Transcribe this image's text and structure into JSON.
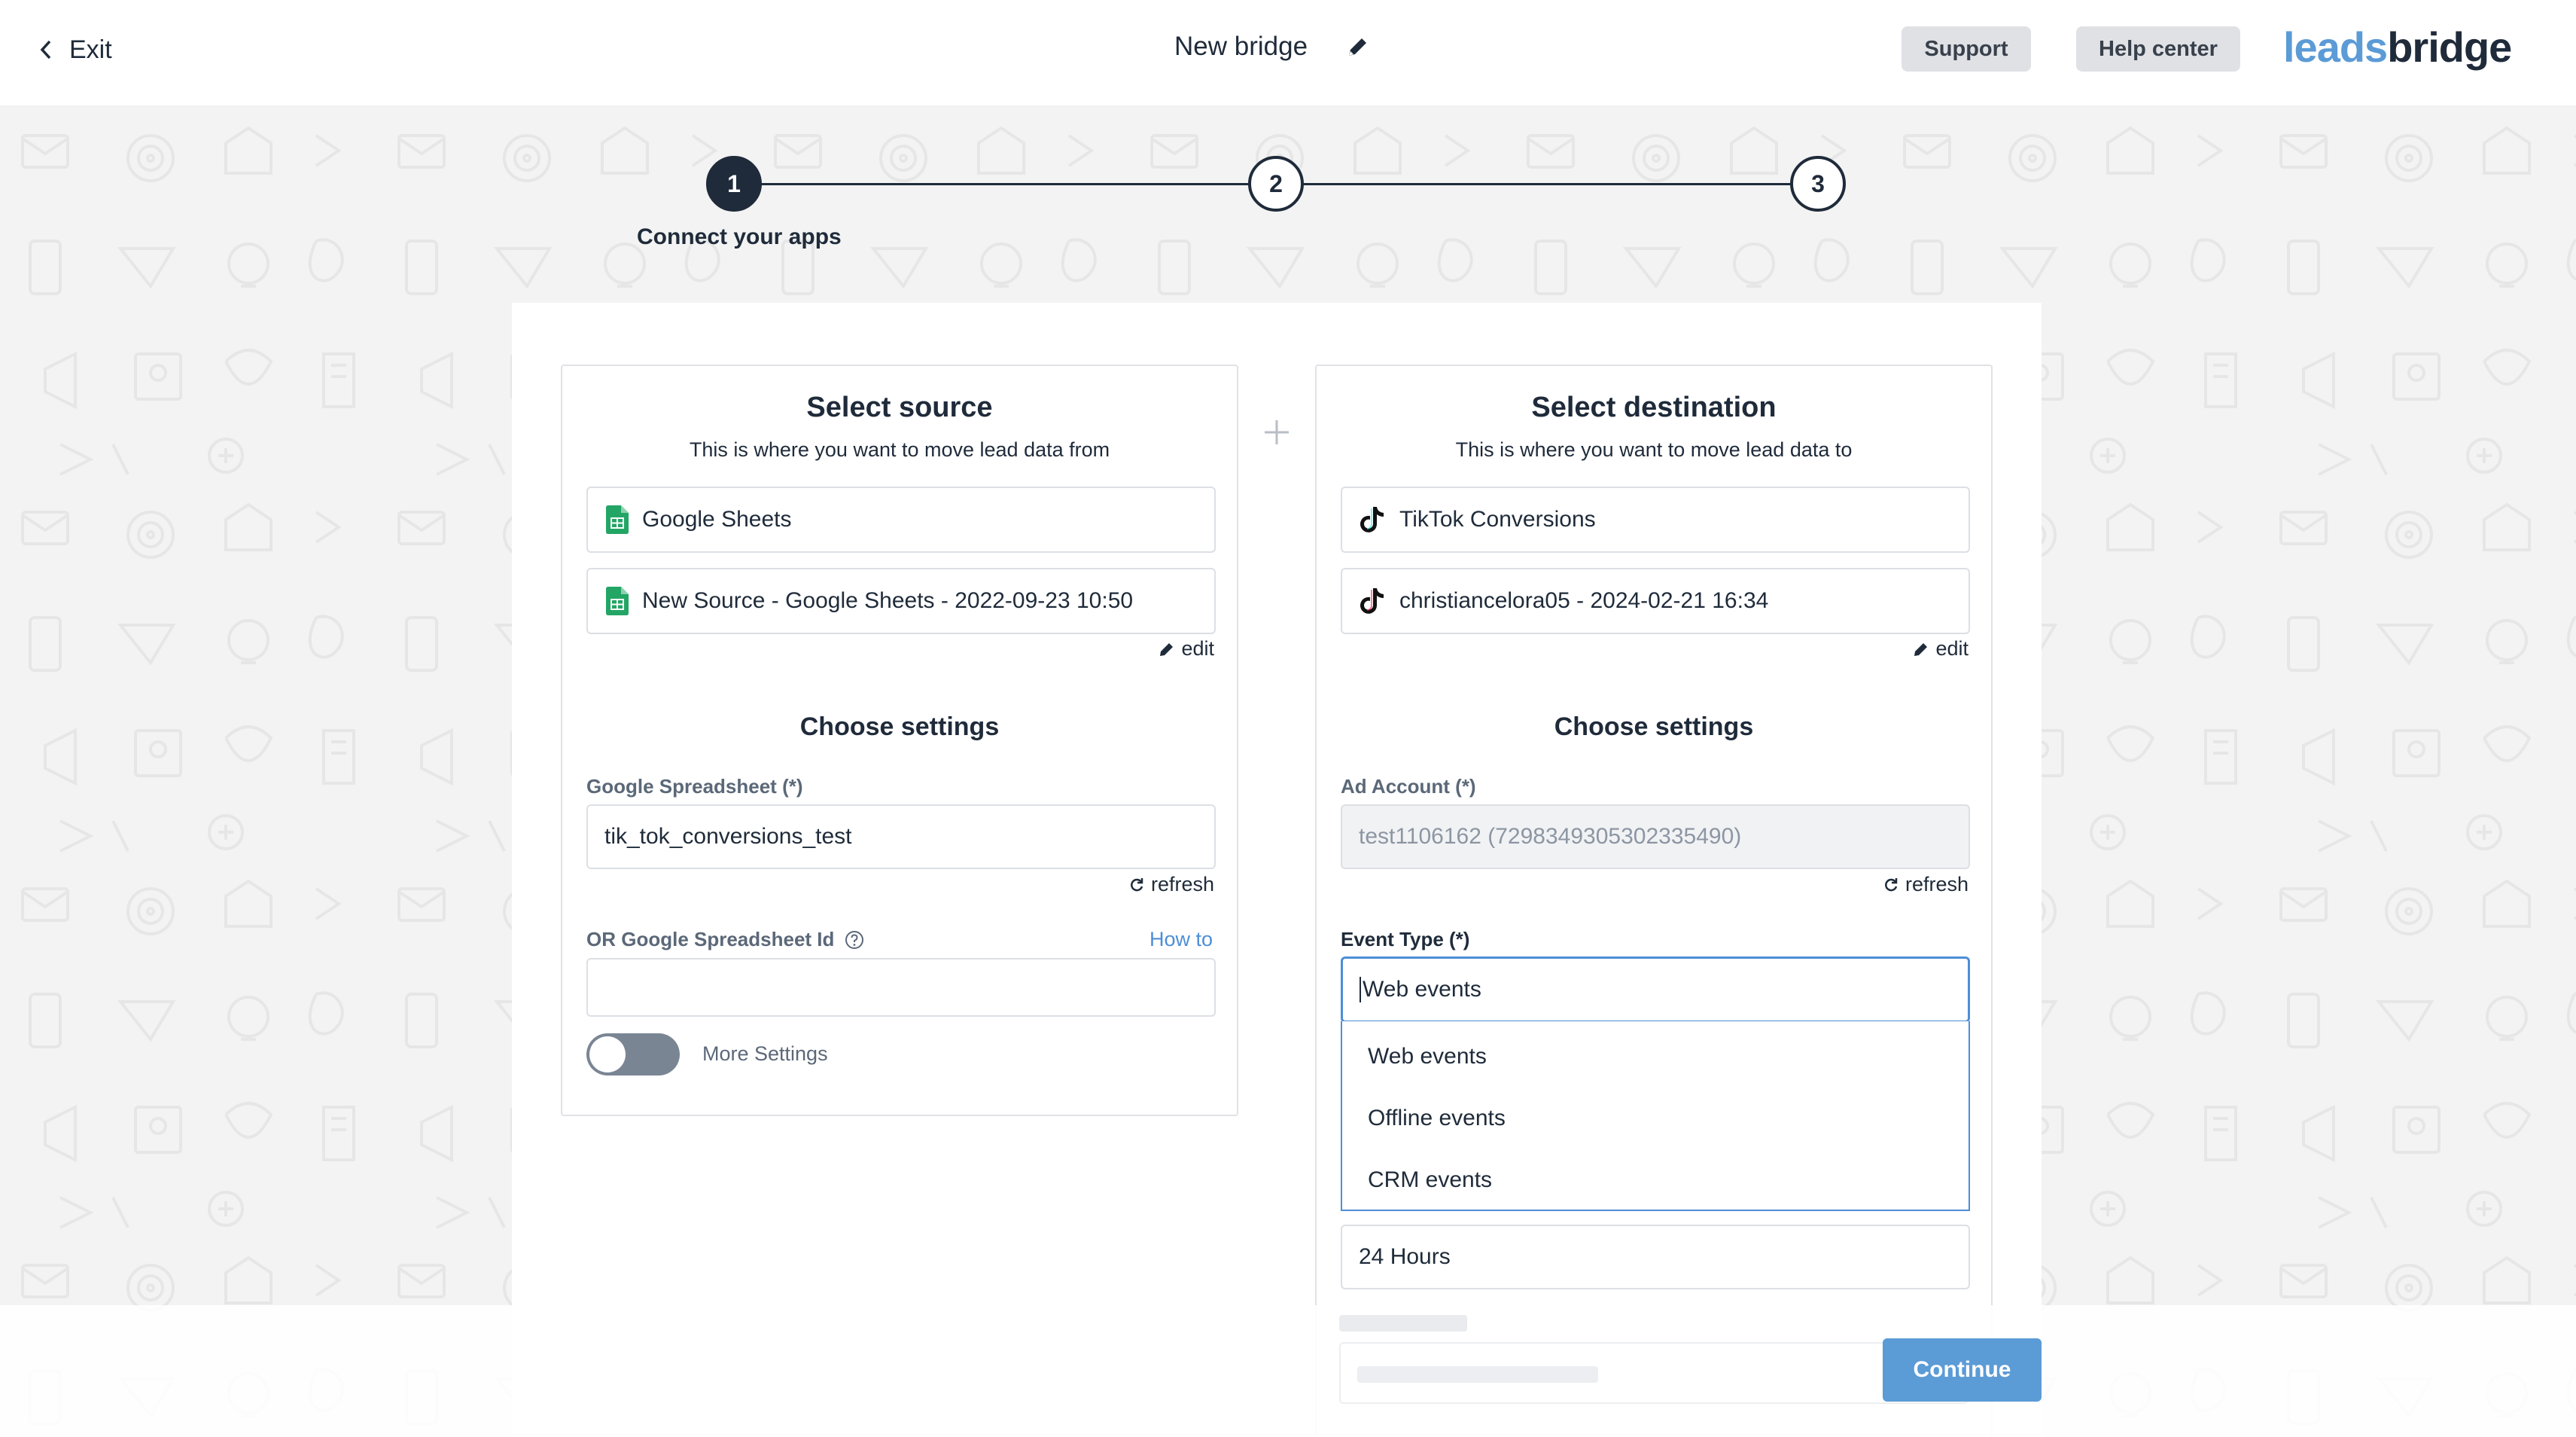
{
  "header": {
    "exit_label": "Exit",
    "bridge_name": "New bridge",
    "support_label": "Support",
    "help_center_label": "Help center",
    "logo_part1": "leads",
    "logo_part2": "bridge"
  },
  "stepper": {
    "steps": [
      "1",
      "2",
      "3"
    ],
    "active_label": "Connect your apps"
  },
  "source": {
    "title": "Select source",
    "subtitle": "This is where you want to move lead data from",
    "app_name": "Google Sheets",
    "connection_name": "New Source - Google Sheets - 2022-09-23 10:50",
    "edit_label": "edit",
    "settings_title": "Choose settings",
    "spreadsheet_label": "Google Spreadsheet",
    "required_mark": "(*)",
    "spreadsheet_value": "tik_tok_conversions_test",
    "refresh_label": "refresh",
    "spreadsheet_id_label": "OR Google Spreadsheet Id",
    "how_to_label": "How to",
    "spreadsheet_id_value": "",
    "more_settings_label": "More Settings"
  },
  "destination": {
    "title": "Select destination",
    "subtitle": "This is where you want to move lead data to",
    "app_name": "TikTok Conversions",
    "connection_name": "christiancelora05 - 2024-02-21 16:34",
    "edit_label": "edit",
    "settings_title": "Choose settings",
    "ad_account_label": "Ad Account",
    "required_mark": "(*)",
    "ad_account_value": "test1106162 (7298349305302335490)",
    "refresh_label": "refresh",
    "event_type_label": "Event Type",
    "event_type_value": "Web events",
    "event_type_options": [
      "Web events",
      "Offline events",
      "CRM events"
    ],
    "window_value": "24 Hours"
  },
  "footer": {
    "continue_label": "Continue"
  },
  "colors": {
    "accent": "#5b9bd6",
    "dark": "#1f2b3a",
    "focus_border": "#4d8ed8"
  }
}
